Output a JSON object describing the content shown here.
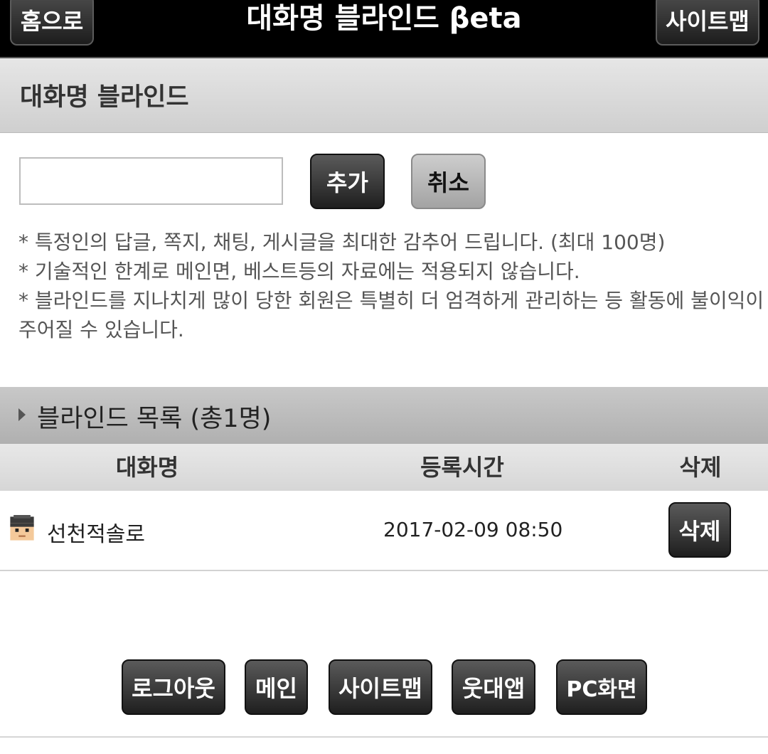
{
  "topbar": {
    "home_label": "홈으로",
    "title": "대화명 블라인드 βeta",
    "sitemap_label": "사이트맵"
  },
  "section": {
    "title": "대화명 블라인드"
  },
  "form": {
    "input_value": "",
    "add_label": "추가",
    "cancel_label": "취소"
  },
  "notes": [
    "* 특정인의 답글, 쪽지, 채팅, 게시글을 최대한 감추어 드립니다. (최대 100명)",
    "* 기술적인 한계로 메인면, 베스트등의 자료에는 적용되지 않습니다.",
    "* 블라인드를 지나치게 많이 당한 회원은 특별히 더 엄격하게 관리하는 등 활동에 불이익이",
    "주어질 수 있습니다."
  ],
  "list": {
    "title": "블라인드 목록 (총1명)",
    "columns": [
      "대화명",
      "등록시간",
      "삭제"
    ],
    "rows": [
      {
        "name": "선천적솔로",
        "time": "2017-02-09 08:50",
        "delete_label": "삭제"
      }
    ]
  },
  "footer": {
    "buttons": [
      "로그아웃",
      "메인",
      "사이트맵",
      "웃대앱",
      "PC화면"
    ]
  },
  "colors": {
    "topbar_bg": "#000000",
    "button_dark": "#2a2a2a",
    "button_gray": "#b5b5b5",
    "section_bg": "#d9d9d9"
  }
}
